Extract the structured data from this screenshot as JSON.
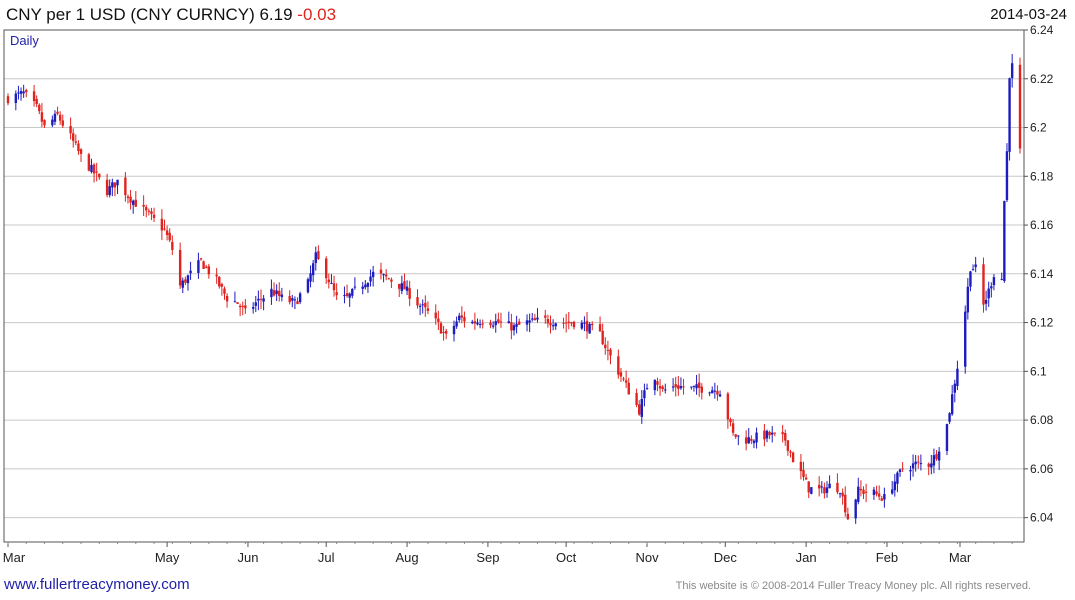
{
  "header": {
    "title": "CNY per 1 USD (CNY CURNCY) 6.19",
    "change": "-0.03",
    "date": "2014-03-24"
  },
  "footer": {
    "site": "www.fullertreacymoney.com",
    "copyright": "This website is © 2008-2014 Fuller Treacy Money plc. All rights reserved."
  },
  "colors": {
    "up": "#1c1cbf",
    "down": "#e0231e",
    "grid": "#c8c8c8",
    "axis": "#555555"
  },
  "chart_data": {
    "type": "candlestick",
    "title": "CNY per 1 USD (CNY CURNCY) 6.19 -0.03",
    "period_label": "Daily",
    "ylim": [
      6.03,
      6.24
    ],
    "y_ticks": [
      6.04,
      6.06,
      6.08,
      6.1,
      6.12,
      6.14,
      6.16,
      6.18,
      6.2,
      6.22,
      6.24
    ],
    "y_tick_labels": [
      "6.04",
      "6.06",
      "6.08",
      "6.1",
      "6.12",
      "6.14",
      "6.16",
      "6.18",
      "6.2",
      "6.22",
      "6.24"
    ],
    "x_range": [
      "2013-03-01",
      "2014-03-24"
    ],
    "x_ticks": [
      "2013-03-01",
      "2013-05-01",
      "2013-06-01",
      "2013-07-01",
      "2013-08-01",
      "2013-09-01",
      "2013-10-01",
      "2013-11-01",
      "2013-12-01",
      "2014-01-01",
      "2014-02-01",
      "2014-03-01"
    ],
    "x_tick_labels": [
      "Mar",
      "May",
      "Jun",
      "Jul",
      "Aug",
      "Sep",
      "Oct",
      "Nov",
      "Dec",
      "Jan",
      "Feb",
      "Mar"
    ],
    "close_path": [
      [
        "2013-03-01",
        6.212
      ],
      [
        "2013-03-07",
        6.214
      ],
      [
        "2013-03-12",
        6.208
      ],
      [
        "2013-03-15",
        6.2
      ],
      [
        "2013-03-20",
        6.205
      ],
      [
        "2013-03-25",
        6.196
      ],
      [
        "2013-03-29",
        6.188
      ],
      [
        "2013-04-04",
        6.18
      ],
      [
        "2013-04-08",
        6.174
      ],
      [
        "2013-04-12",
        6.178
      ],
      [
        "2013-04-16",
        6.172
      ],
      [
        "2013-04-22",
        6.166
      ],
      [
        "2013-04-26",
        6.162
      ],
      [
        "2013-04-30",
        6.158
      ],
      [
        "2013-05-03",
        6.15
      ],
      [
        "2013-05-06",
        6.135
      ],
      [
        "2013-05-10",
        6.14
      ],
      [
        "2013-05-14",
        6.145
      ],
      [
        "2013-05-20",
        6.137
      ],
      [
        "2013-05-24",
        6.13
      ],
      [
        "2013-05-28",
        6.128
      ],
      [
        "2013-05-31",
        6.124
      ],
      [
        "2013-06-04",
        6.128
      ],
      [
        "2013-06-10",
        6.133
      ],
      [
        "2013-06-14",
        6.13
      ],
      [
        "2013-06-19",
        6.128
      ],
      [
        "2013-06-24",
        6.136
      ],
      [
        "2013-06-27",
        6.147
      ],
      [
        "2013-07-01",
        6.14
      ],
      [
        "2013-07-05",
        6.13
      ],
      [
        "2013-07-09",
        6.13
      ],
      [
        "2013-07-15",
        6.136
      ],
      [
        "2013-07-19",
        6.14
      ],
      [
        "2013-07-25",
        6.138
      ],
      [
        "2013-07-31",
        6.134
      ],
      [
        "2013-08-05",
        6.128
      ],
      [
        "2013-08-09",
        6.124
      ],
      [
        "2013-08-13",
        6.119
      ],
      [
        "2013-08-16",
        6.114
      ],
      [
        "2013-08-21",
        6.122
      ],
      [
        "2013-08-26",
        6.12
      ],
      [
        "2013-08-30",
        6.121
      ],
      [
        "2013-09-05",
        6.12
      ],
      [
        "2013-09-11",
        6.118
      ],
      [
        "2013-09-16",
        6.12
      ],
      [
        "2013-09-23",
        6.121
      ],
      [
        "2013-09-30",
        6.12
      ],
      [
        "2013-10-04",
        6.12
      ],
      [
        "2013-10-08",
        6.119
      ],
      [
        "2013-10-14",
        6.115
      ],
      [
        "2013-10-17",
        6.108
      ],
      [
        "2013-10-21",
        6.1
      ],
      [
        "2013-10-25",
        6.092
      ],
      [
        "2013-10-29",
        6.084
      ],
      [
        "2013-11-01",
        6.094
      ],
      [
        "2013-11-04",
        6.098
      ],
      [
        "2013-11-07",
        6.092
      ],
      [
        "2013-11-12",
        6.094
      ],
      [
        "2013-11-18",
        6.093
      ],
      [
        "2013-11-25",
        6.093
      ],
      [
        "2013-11-29",
        6.092
      ],
      [
        "2013-12-04",
        6.074
      ],
      [
        "2013-12-09",
        6.072
      ],
      [
        "2013-12-13",
        6.073
      ],
      [
        "2013-12-18",
        6.074
      ],
      [
        "2013-12-24",
        6.072
      ],
      [
        "2013-12-27",
        6.064
      ],
      [
        "2014-01-02",
        6.052
      ],
      [
        "2014-01-07",
        6.051
      ],
      [
        "2014-01-10",
        6.053
      ],
      [
        "2014-01-14",
        6.052
      ],
      [
        "2014-01-17",
        6.04
      ],
      [
        "2014-01-21",
        6.051
      ],
      [
        "2014-01-27",
        6.05
      ],
      [
        "2014-01-31",
        6.048
      ],
      [
        "2014-02-04",
        6.055
      ],
      [
        "2014-02-07",
        6.06
      ],
      [
        "2014-02-12",
        6.062
      ],
      [
        "2014-02-17",
        6.062
      ],
      [
        "2014-02-20",
        6.066
      ],
      [
        "2014-02-24",
        6.078
      ],
      [
        "2014-02-26",
        6.09
      ],
      [
        "2014-02-28",
        6.102
      ],
      [
        "2014-03-03",
        6.125
      ],
      [
        "2014-03-05",
        6.143
      ],
      [
        "2014-03-07",
        6.142
      ],
      [
        "2014-03-10",
        6.127
      ],
      [
        "2014-03-12",
        6.133
      ],
      [
        "2014-03-14",
        6.14
      ],
      [
        "2014-03-17",
        6.138
      ],
      [
        "2014-03-18",
        6.17
      ],
      [
        "2014-03-19",
        6.19
      ],
      [
        "2014-03-20",
        6.222
      ],
      [
        "2014-03-21",
        6.225
      ],
      [
        "2014-03-24",
        6.19
      ]
    ]
  }
}
